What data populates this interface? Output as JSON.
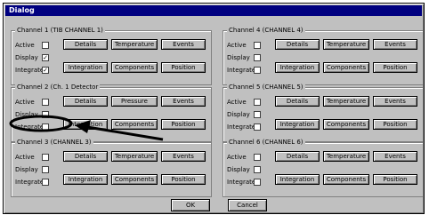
{
  "window": {
    "title": "Dialog"
  },
  "groups": [
    {
      "title": "Channel 1 (TIB CHANNEL 1)",
      "rows": [
        {
          "label": "Active",
          "checked": ""
        },
        {
          "label": "Display",
          "checked": "✓"
        },
        {
          "label": "Integrate",
          "checked": "✓"
        }
      ],
      "buttons": [
        "Details",
        "Temperature",
        "Events",
        "Integration",
        "Components",
        "Position"
      ]
    },
    {
      "title": "Channel 4 (CHANNEL 4)",
      "rows": [
        {
          "label": "Active",
          "checked": ""
        },
        {
          "label": "Display",
          "checked": ""
        },
        {
          "label": "Integrate",
          "checked": ""
        }
      ],
      "buttons": [
        "Details",
        "Temperature",
        "Events",
        "Integration",
        "Components",
        "Position"
      ]
    },
    {
      "title": "Channel 2 (Ch. 1 Detector",
      "rows": [
        {
          "label": "Active",
          "checked": ""
        },
        {
          "label": "Display",
          "checked": ""
        },
        {
          "label": "Integrate",
          "checked": ""
        }
      ],
      "buttons": [
        "Details",
        "Pressure",
        "Events",
        "Integration",
        "Components",
        "Position"
      ]
    },
    {
      "title": "Channel 5 (CHANNEL 5)",
      "rows": [
        {
          "label": "Active",
          "checked": ""
        },
        {
          "label": "Display",
          "checked": ""
        },
        {
          "label": "Integrate",
          "checked": ""
        }
      ],
      "buttons": [
        "Details",
        "Temperature",
        "Events",
        "Integration",
        "Components",
        "Position"
      ]
    },
    {
      "title": "Channel 3 (CHANNEL 3)",
      "rows": [
        {
          "label": "Active",
          "checked": ""
        },
        {
          "label": "Display",
          "checked": ""
        },
        {
          "label": "Integrate",
          "checked": ""
        }
      ],
      "buttons": [
        "Details",
        "Temperature",
        "Events",
        "Integration",
        "Components",
        "Position"
      ]
    },
    {
      "title": "Channel 6 (CHANNEL 6)",
      "rows": [
        {
          "label": "Active",
          "checked": ""
        },
        {
          "label": "Display",
          "checked": ""
        },
        {
          "label": "Integrate",
          "checked": ""
        }
      ],
      "buttons": [
        "Details",
        "Temperature",
        "Events",
        "Integration",
        "Components",
        "Position"
      ]
    }
  ],
  "footer": {
    "ok_label": "OK",
    "cancel_label": "Cancel"
  },
  "annotation": {
    "color": "#000000"
  }
}
